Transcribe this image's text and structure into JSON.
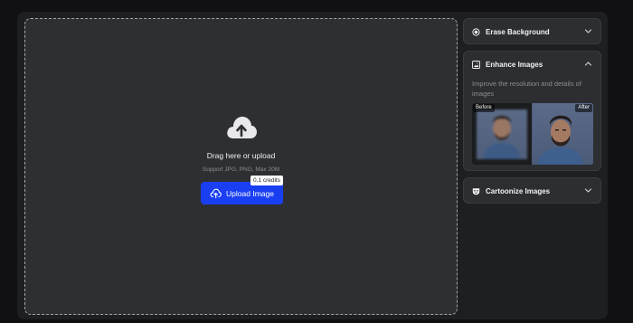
{
  "upload": {
    "drag_text": "Drag here or upload",
    "support_text": "Support JPG, PNG, Max 20M",
    "button_label": "Upload Image",
    "credits_badge": "0.1 credits"
  },
  "tools": {
    "erase": {
      "title": "Erase Background",
      "icon": "erase-background-icon",
      "expanded": false
    },
    "enhance": {
      "title": "Enhance Images",
      "icon": "enhance-image-icon",
      "expanded": true,
      "description": "Improve the resolution and details of images",
      "before_label": "Before",
      "after_label": "After"
    },
    "cartoonize": {
      "title": "Cartoonize Images",
      "icon": "cartoon-face-icon",
      "expanded": false
    }
  },
  "colors": {
    "accent": "#1a3ff3",
    "background": "#111113",
    "panel": "#2d2e31"
  }
}
